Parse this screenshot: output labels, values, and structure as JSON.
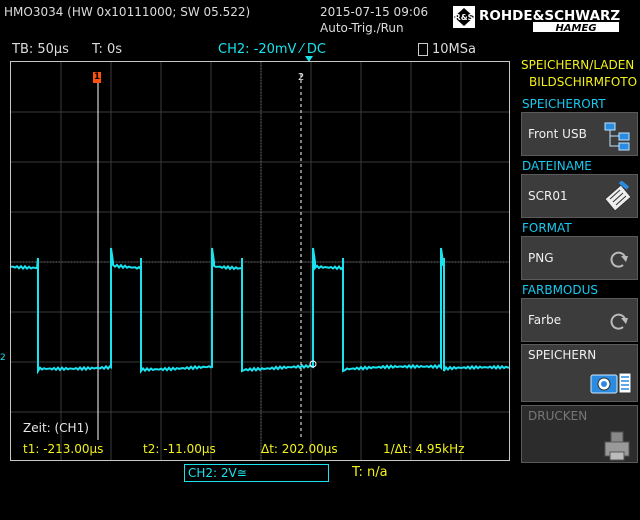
{
  "header": {
    "device": "HMO3034 (HW 0x10111000; SW 05.522)",
    "datetime": "2015-07-15 09:06",
    "trigger_status": "Auto-Trig./Run",
    "logo_text": "ROHDE&SCHWARZ",
    "logo_sub": "HAMEG"
  },
  "status_bar": {
    "timebase": "TB: 50µs",
    "trigger_time": "T: 0s",
    "trigger_source": "CH2: -20mV ⁄ DC",
    "sample_rate": "10MSa"
  },
  "plot": {
    "marker_1": "1",
    "marker_2": "2",
    "ch_marker": "2",
    "zeit_label": "Zeit: (CH1)",
    "measurements": {
      "t1": "t1: -213.00µs",
      "t2": "t2: -11.00µs",
      "dt": "Δt: 202.00µs",
      "inv_dt": "1/Δt: 4.95kHz"
    }
  },
  "bottom": {
    "channel_scale": "CH2: 2V≅",
    "trigger": "T: n/a"
  },
  "right_panel": {
    "title_line1": "SPEICHERN/LADEN",
    "title_line2": "BILDSCHIRMFOTO",
    "sections": [
      {
        "title": "SPEICHERORT",
        "value": "Front USB"
      },
      {
        "title": "DATEINAME",
        "value": "SCR01"
      },
      {
        "title": "FORMAT",
        "value": "PNG"
      },
      {
        "title": "FARBMODUS",
        "value": "Farbe"
      }
    ],
    "save_label": "SPEICHERN",
    "print_label": "DRUCKEN"
  },
  "colors": {
    "trace": "#19e3ef",
    "grid": "#3a3a3a",
    "cursor_1": "#ff5010",
    "accent_label": "#19c9ef",
    "measurement": "#f2f21a"
  }
}
